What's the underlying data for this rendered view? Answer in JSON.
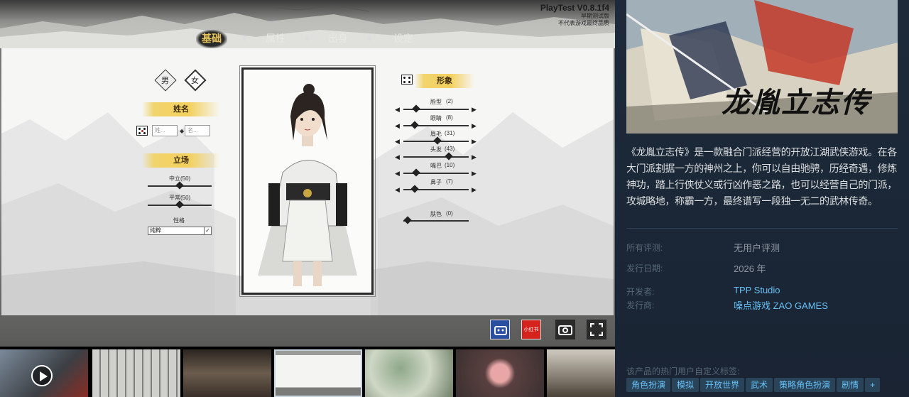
{
  "game": {
    "build": "PlayTest V0.8.1f4",
    "build_sub1": "早期测试版",
    "build_sub2": "不代表游戏最终品质",
    "tabs": [
      "基础",
      "属性",
      "出身",
      "设定"
    ],
    "gender": {
      "male": "男",
      "female": "女"
    },
    "name_section": "姓名",
    "name_placeholders": [
      "姓...",
      "名..."
    ],
    "stance_section": "立场",
    "stance_sliders": [
      "中立(50)",
      "平常(50)"
    ],
    "personality_label": "性格",
    "personality_value": "纯粹",
    "appearance_section": "形象",
    "appearance_sliders": [
      {
        "label": "脸型",
        "value": "(2)"
      },
      {
        "label": "眼睛",
        "value": "(8)"
      },
      {
        "label": "眉毛",
        "value": "(31)"
      },
      {
        "label": "头发",
        "value": "(43)"
      },
      {
        "label": "嘴巴",
        "value": "(10)"
      },
      {
        "label": "鼻子",
        "value": "(7)"
      }
    ],
    "skin_label": "肤色",
    "skin_value": "(0)",
    "icon_badge": "小红书"
  },
  "store": {
    "capsule_title": "龙胤立志传",
    "description": "《龙胤立志传》是一款融合门派经营的开放江湖武侠游戏。在各大门派割据一方的神州之上，你可以自由驰骋，历经奇遇，修炼神功，踏上行侠仗义或行凶作恶之路，也可以经营自己的门派，攻城略地，称霸一方，最终谱写一段独一无二的武林传奇。",
    "reviews_label": "所有评测:",
    "reviews_value": "无用户评测",
    "release_label": "发行日期:",
    "release_value": "2026 年",
    "developer_label": "开发者:",
    "developer_value": "TPP Studio",
    "publisher_label": "发行商:",
    "publisher_value": "噪点游戏 ZAO GAMES",
    "tags_label": "该产品的热门用户自定义标签:",
    "tags": [
      "角色扮演",
      "模拟",
      "开放世界",
      "武术",
      "策略角色扮演",
      "剧情",
      "+"
    ]
  },
  "thumbnails": [
    "video-trailer",
    "screenshot-1",
    "screenshot-2",
    "screenshot-3",
    "screenshot-4",
    "screenshot-5",
    "screenshot-6"
  ],
  "colors": {
    "accent_link": "#66c0f4",
    "bg": "#1b2838",
    "tag_text": "#67c1f5",
    "brush_gold": "#f3d05c"
  }
}
